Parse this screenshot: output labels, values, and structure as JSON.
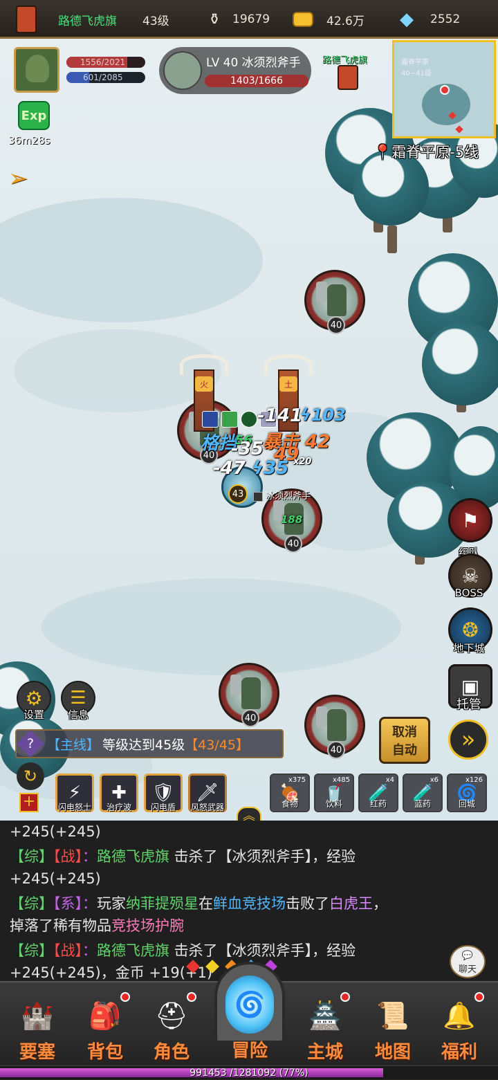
{
  "top": {
    "player_name": "路德飞虎旗",
    "level": "43级",
    "currency1": "19679",
    "currency2": "42.6万",
    "diamonds": "2552"
  },
  "player": {
    "hp": "1556/2021",
    "mp": "601/2085",
    "exp_label": "Exp",
    "exp_timer": "36m28s"
  },
  "target": {
    "title": "LV 40 冰须烈斧手",
    "hp": "1403/1666",
    "guild": "路德飞虎旗"
  },
  "minimap": {
    "location": "霜脊平原-5线",
    "label1": "霜脊平原",
    "label2": "40~41级"
  },
  "enemies": [
    {
      "level": "40"
    },
    {
      "level": "40"
    },
    {
      "level": "40"
    },
    {
      "level": "40"
    },
    {
      "level": "40"
    }
  ],
  "player_level_badge": "43",
  "player_tag": "冰须烈斧手",
  "damage": {
    "d1": "-141",
    "d2": "103",
    "d3": "格挡",
    "d4": "暴击 42",
    "d5": "-35",
    "d6": "49",
    "d7": "-47",
    "d8": "35",
    "d9": "188",
    "d10": "56",
    "d11": "x20"
  },
  "totems": [
    "火",
    "土"
  ],
  "side_buttons": {
    "team": "组队",
    "boss": "BOSS",
    "dungeon": "地下城",
    "auto": "托管"
  },
  "left_buttons": {
    "settings": "设置",
    "info": "信息"
  },
  "quest": {
    "tag": "【主线】",
    "text": "等级达到45级",
    "progress": "【43/45】"
  },
  "auto_button": {
    "line1": "取消",
    "line2": "自动"
  },
  "skills": [
    {
      "name": "闪电怒士",
      "icon": "⚡"
    },
    {
      "name": "治疗波",
      "icon": "✚"
    },
    {
      "name": "闪电盾",
      "icon": "🛡"
    },
    {
      "name": "风怒武器",
      "icon": "🗡"
    }
  ],
  "items": [
    {
      "name": "食物",
      "count": "x375",
      "icon": "🍖"
    },
    {
      "name": "饮料",
      "count": "x485",
      "icon": "🥤"
    },
    {
      "name": "红药",
      "count": "x4",
      "icon": "🧪"
    },
    {
      "name": "蓝药",
      "count": "x6",
      "icon": "🧪"
    },
    {
      "name": "回城",
      "count": "x126",
      "icon": "🌀"
    }
  ],
  "chat": {
    "line0": "+245(+245)",
    "l1_tag1": "【综】",
    "l1_tag2": "【战】",
    "l1_colon": "：",
    "l1_name": "路德飞虎旗",
    "l1_text": " 击杀了【冰须烈斧手】，经验",
    "l1_cont": "+245(+245)",
    "l2_tag1": "【综】",
    "l2_tag2": "【系】",
    "l2_colon": "：",
    "l2_a": "玩家",
    "l2_name": "纳菲提殒星",
    "l2_b": "在",
    "l2_place": "鲜血竞技场",
    "l2_c": "击败了",
    "l2_boss": "白虎王",
    "l2_d": "，",
    "l2_e": "掉落了稀有物品",
    "l2_item": "竞技场护腕",
    "l3_tag1": "【综】",
    "l3_tag2": "【战】",
    "l3_colon": "：",
    "l3_name": "路德飞虎旗",
    "l3_text": " 击杀了【冰须烈斧手】，经验",
    "l3_cont": "+245(+245)，金币 +19(+1)",
    "chat_button": "聊天"
  },
  "nav": [
    {
      "label": "要塞",
      "icon": "🏰",
      "dot": false
    },
    {
      "label": "背包",
      "icon": "🎒",
      "dot": true
    },
    {
      "label": "角色",
      "icon": "⛑",
      "dot": true
    },
    {
      "label": "冒险",
      "icon": "🌀",
      "dot": false
    },
    {
      "label": "主城",
      "icon": "🏯",
      "dot": true
    },
    {
      "label": "地图",
      "icon": "📜",
      "dot": false
    },
    {
      "label": "福利",
      "icon": "🔔",
      "dot": true
    }
  ],
  "xp": {
    "text": "991453 /1281092 (77%)",
    "fraction": 0.77
  }
}
